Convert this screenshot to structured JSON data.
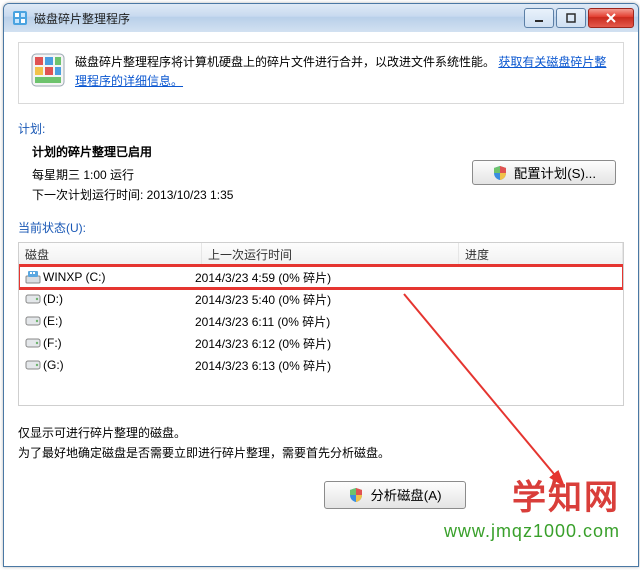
{
  "window": {
    "title": "磁盘碎片整理程序"
  },
  "info": {
    "text": "磁盘碎片整理程序将计算机硬盘上的碎片文件进行合并，以改进文件系统性能。",
    "link": "获取有关磁盘碎片整理程序的详细信息。"
  },
  "schedule": {
    "label": "计划:",
    "title": "计划的碎片整理已启用",
    "freq": "每星期三  1:00 运行",
    "next": "下一次计划运行时间: 2013/10/23 1:35",
    "config_btn": "配置计划(S)..."
  },
  "status": {
    "label": "当前状态(U):",
    "col_disk": "磁盘",
    "col_last": "上一次运行时间",
    "col_prog": "进度"
  },
  "disks": [
    {
      "name": "WINXP (C:)",
      "last": "2014/3/23 4:59 (0% 碎片)",
      "hl": true,
      "type": "win"
    },
    {
      "name": "(D:)",
      "last": "2014/3/23 5:40 (0% 碎片)",
      "hl": false,
      "type": "hdd"
    },
    {
      "name": "(E:)",
      "last": "2014/3/23 6:11 (0% 碎片)",
      "hl": false,
      "type": "hdd"
    },
    {
      "name": "(F:)",
      "last": "2014/3/23 6:12 (0% 碎片)",
      "hl": false,
      "type": "hdd"
    },
    {
      "name": "(G:)",
      "last": "2014/3/23 6:13 (0% 碎片)",
      "hl": false,
      "type": "hdd"
    }
  ],
  "footer": {
    "line1": "仅显示可进行碎片整理的磁盘。",
    "line2": "为了最好地确定磁盘是否需要立即进行碎片整理，需要首先分析磁盘。"
  },
  "buttons": {
    "analyze": "分析磁盘(A)"
  },
  "watermark": {
    "brand": "学知网",
    "url": "www.jmqz1000.com"
  }
}
